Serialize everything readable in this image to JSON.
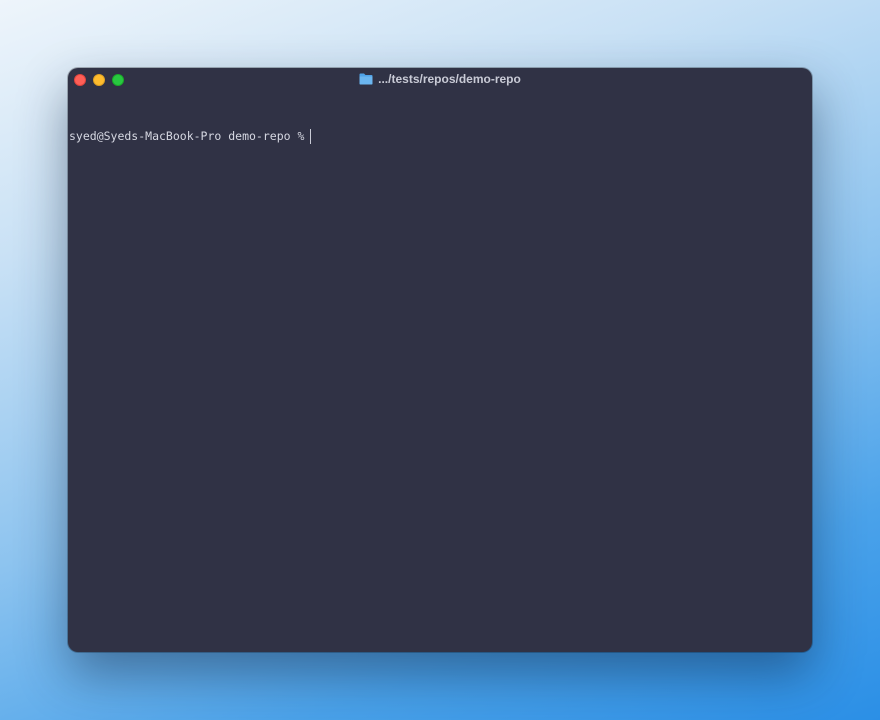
{
  "window": {
    "title": ".../tests/repos/demo-repo",
    "title_icon": "folder-icon",
    "background": "#303245"
  },
  "terminal": {
    "prompt": "syed@Syeds-MacBook-Pro demo-repo %",
    "input": ""
  },
  "colors": {
    "close": "#fe5f57",
    "minimize": "#febc2e",
    "zoom": "#28c840",
    "folder": "#4fa3e8"
  }
}
